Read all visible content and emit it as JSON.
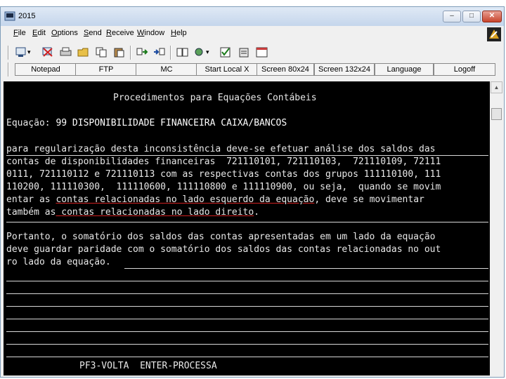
{
  "window": {
    "title": "2015",
    "min_glyph": "–",
    "max_glyph": "□",
    "close_glyph": "✕"
  },
  "menu": [
    "File",
    "Edit",
    "Options",
    "Send",
    "Receive",
    "Window",
    "Help"
  ],
  "toolbar_buttons": [
    "Notepad",
    "FTP",
    "MC",
    "Start Local X",
    "Screen 80x24",
    "Screen 132x24",
    "Language",
    "Logoff"
  ],
  "terminal": {
    "heading": "Procedimentos para Equações Contábeis",
    "equation_label": "Equação: ",
    "equation_value": "99 DISPONIBILIDADE FINANCEIRA CAIXA/BANCOS",
    "p1": {
      "l1": "para regularização desta inconsistência deve-se efetuar análise dos saldos das",
      "l2": "contas de disponibilidades financeiras  721110101, 721110103,  721110109, 72111",
      "l3": "0111, 721110112 e 721110113 com as respectivas contas dos grupos 111110100, 111",
      "l4": "110200, 111110300,  111110600, 111110800 e 111110900, ou seja,  quando se movim",
      "l5_a": "entar as ",
      "l5_b": "contas relacionadas no lado esquerdo da equação",
      "l5_c": ", deve se movimentar",
      "l6_a": "também as",
      "l6_b": " contas relacionadas no lado direito",
      "l6_c": "."
    },
    "p2": {
      "l1": "Portanto, o somatório dos saldos das contas apresentadas em um lado da equação",
      "l2": "deve guardar paridade com o somatório dos saldos das contas relacionadas no out",
      "l3": "ro lado da equação."
    },
    "footer": "PF3-VOLTA  ENTER-PROCESSA"
  }
}
